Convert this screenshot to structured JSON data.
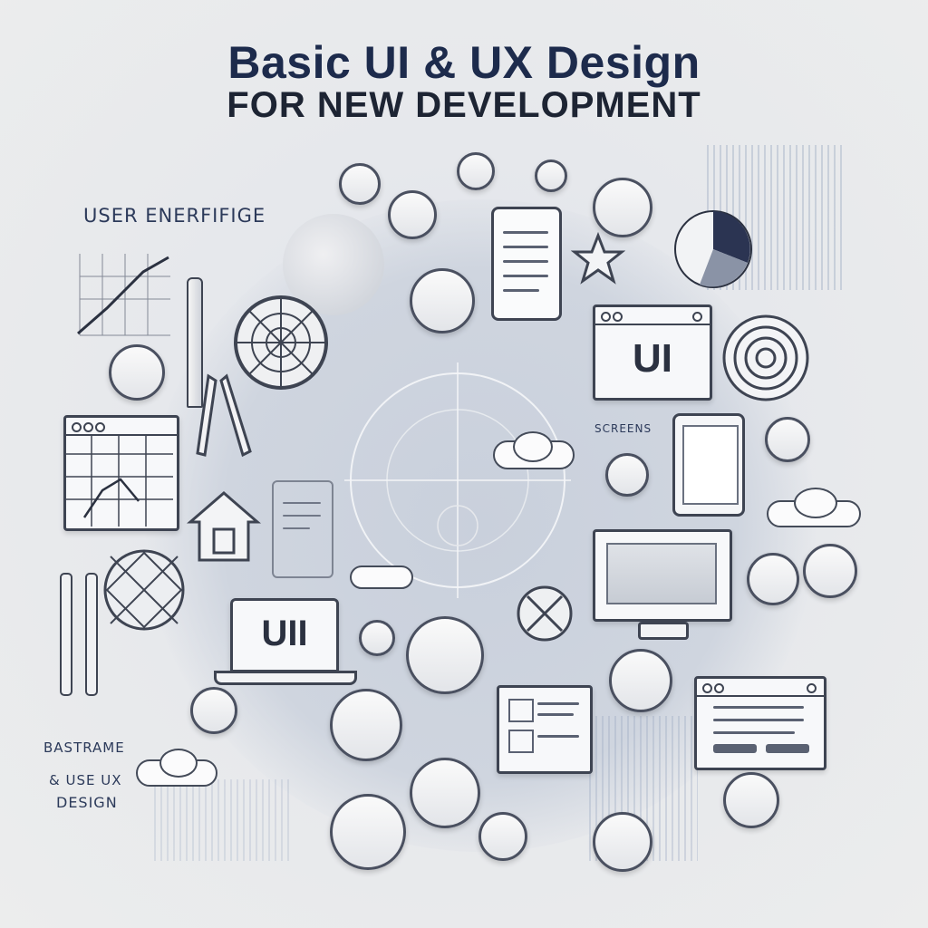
{
  "header": {
    "title_line1": "Basic UI & UX Design",
    "title_line2": "FOR NEW DEVELOPMENT"
  },
  "labels": {
    "user_interface": "USER ENERFIFIGE",
    "screens": "SCREENS",
    "ui_window": "UI",
    "ui_laptop": "UII",
    "bastrame": "BASTRAME",
    "use_ux": "& USE UX",
    "design": "DESIGN"
  },
  "colors": {
    "title": "#1d2b4c",
    "outline": "#3e4452",
    "disk": "#cfd5df",
    "background": "#eceded"
  }
}
